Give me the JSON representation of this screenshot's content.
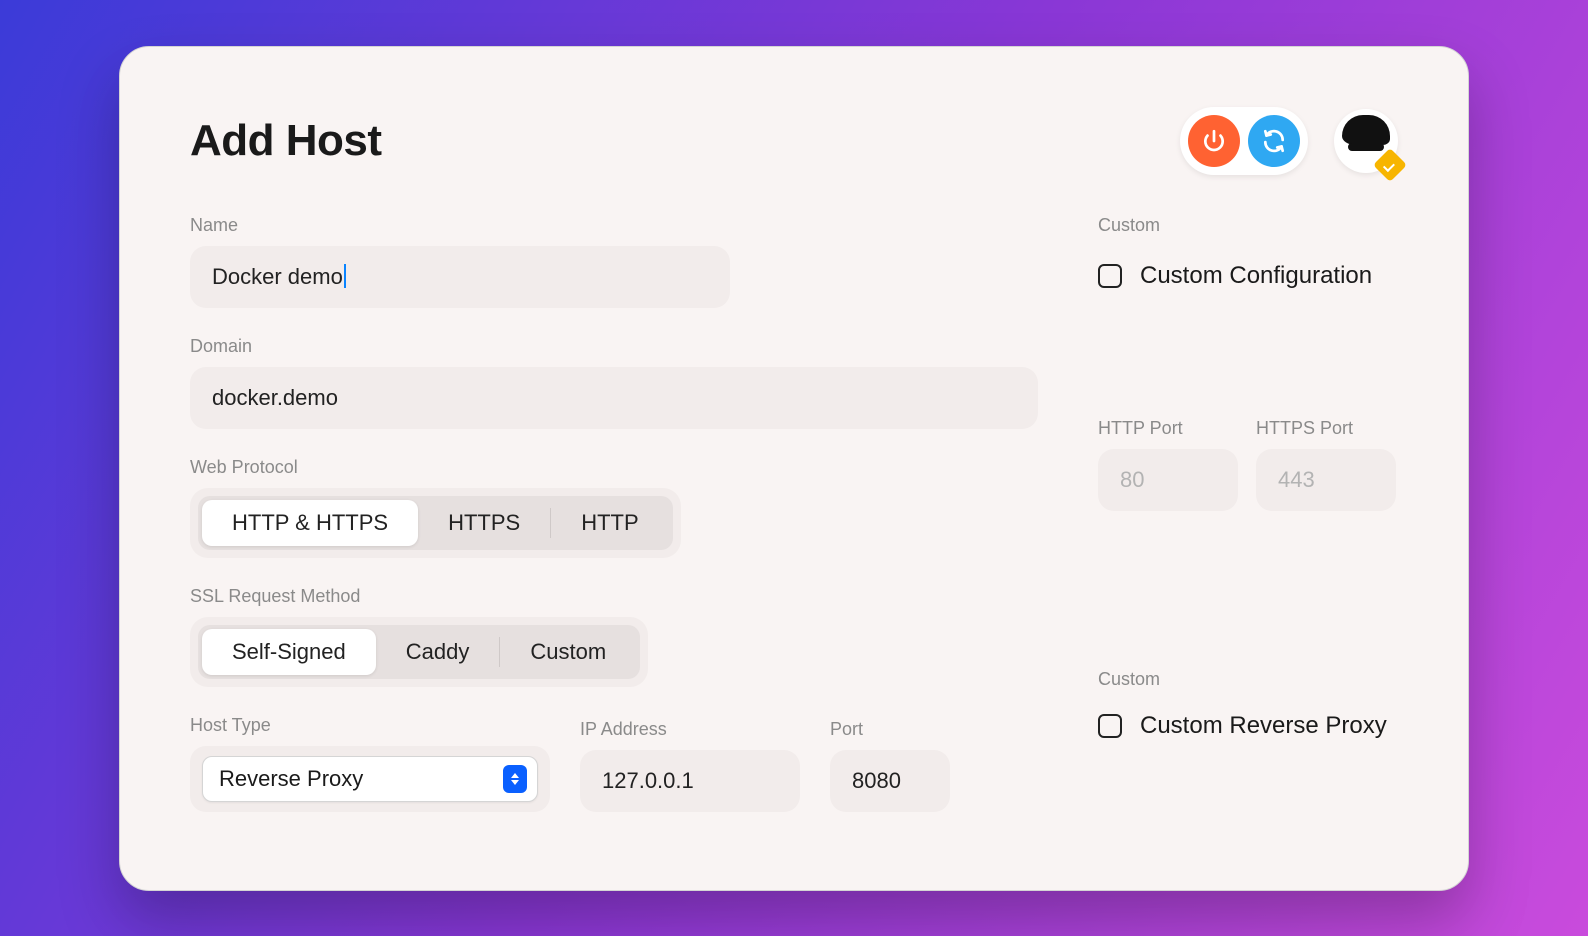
{
  "header": {
    "title": "Add Host",
    "power_icon": "power-icon",
    "refresh_icon": "refresh-icon"
  },
  "left": {
    "name": {
      "label": "Name",
      "value": "Docker demo"
    },
    "domain": {
      "label": "Domain",
      "value": "docker.demo"
    },
    "web_protocol": {
      "label": "Web Protocol",
      "options": [
        "HTTP & HTTPS",
        "HTTPS",
        "HTTP"
      ],
      "selected_index": 0
    },
    "ssl_method": {
      "label": "SSL Request Method",
      "options": [
        "Self-Signed",
        "Caddy",
        "Custom"
      ],
      "selected_index": 0
    },
    "host_type": {
      "label": "Host Type",
      "value": "Reverse Proxy"
    },
    "ip_address": {
      "label": "IP Address",
      "value": "127.0.0.1"
    },
    "port": {
      "label": "Port",
      "value": "8080"
    }
  },
  "right": {
    "custom1": {
      "label": "Custom",
      "checkbox_label": "Custom Configuration",
      "checked": false
    },
    "http_port": {
      "label": "HTTP Port",
      "placeholder": "80"
    },
    "https_port": {
      "label": "HTTPS Port",
      "placeholder": "443"
    },
    "custom2": {
      "label": "Custom",
      "checkbox_label": "Custom Reverse Proxy",
      "checked": false
    }
  }
}
